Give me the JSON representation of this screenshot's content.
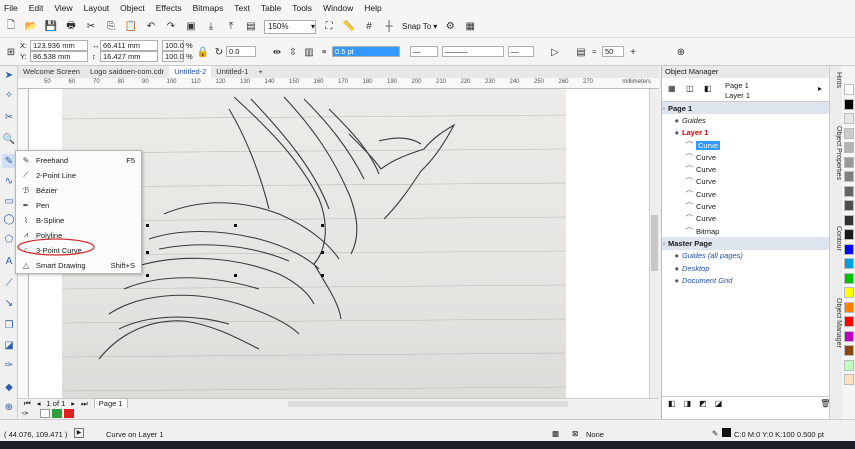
{
  "menu": [
    "File",
    "Edit",
    "View",
    "Layout",
    "Object",
    "Effects",
    "Bitmaps",
    "Text",
    "Table",
    "Tools",
    "Window",
    "Help"
  ],
  "toolbar": {
    "zoom": "150%",
    "snap_label": "Snap To"
  },
  "props": {
    "x": "123.936 mm",
    "y": "86.538 mm",
    "w": "66.411 mm",
    "h": "16.427 mm",
    "scale_x": "100.0",
    "scale_y": "100.0",
    "pct": "%",
    "angle": "0.0",
    "outline": "0.5 pt",
    "smooth": "50"
  },
  "tabs": [
    "Welcome Screen",
    "Logo saidoen-com.cdr",
    "Untitled-2",
    "Untitled-1"
  ],
  "active_tab": 2,
  "ruler_unit": "millimeters",
  "ruler_ticks": [
    "50",
    "60",
    "70",
    "80",
    "90",
    "100",
    "110",
    "120",
    "130",
    "140",
    "150",
    "160",
    "170",
    "180",
    "190",
    "200",
    "210",
    "220",
    "230",
    "240",
    "250",
    "260",
    "270"
  ],
  "flyout": [
    {
      "label": "Freehand",
      "shortcut": "F5",
      "icon": "freehand-icon"
    },
    {
      "label": "2-Point Line",
      "shortcut": "",
      "icon": "line-icon"
    },
    {
      "label": "Bézier",
      "shortcut": "",
      "icon": "bezier-icon"
    },
    {
      "label": "Pen",
      "shortcut": "",
      "icon": "pen-icon"
    },
    {
      "label": "B-Spline",
      "shortcut": "",
      "icon": "bspline-icon"
    },
    {
      "label": "Polyline",
      "shortcut": "",
      "icon": "polyline-icon"
    },
    {
      "label": "3-Point Curve",
      "shortcut": "",
      "icon": "curve-icon"
    },
    {
      "label": "Smart Drawing",
      "shortcut": "Shift+S",
      "icon": "smart-drawing-icon"
    }
  ],
  "docbar": {
    "page_count": "1 of 1",
    "page_tab": "Page 1"
  },
  "status": {
    "coords": "( 44.076, 109.471 )",
    "message": "Curve on Layer 1",
    "fill": "None",
    "outline_info": "C:0 M:0 Y:0 K:100  0.500 pt"
  },
  "object_manager": {
    "title": "Object Manager",
    "page": "Page 1",
    "layer": "Layer 1",
    "rows": [
      {
        "text": "Page 1",
        "level": 0,
        "style": "section"
      },
      {
        "text": "Guides",
        "level": 1,
        "style": "italic"
      },
      {
        "text": "Layer 1",
        "level": 1,
        "style": "red"
      },
      {
        "text": "Curve",
        "level": 2,
        "style": "selected"
      },
      {
        "text": "Curve",
        "level": 2,
        "style": "normal"
      },
      {
        "text": "Curve",
        "level": 2,
        "style": "normal"
      },
      {
        "text": "Curve",
        "level": 2,
        "style": "normal"
      },
      {
        "text": "Curve",
        "level": 2,
        "style": "normal"
      },
      {
        "text": "Curve",
        "level": 2,
        "style": "normal"
      },
      {
        "text": "Curve",
        "level": 2,
        "style": "normal"
      },
      {
        "text": "Bitmap",
        "level": 2,
        "style": "normal"
      },
      {
        "text": "Master Page",
        "level": 0,
        "style": "section"
      },
      {
        "text": "Guides (all pages)",
        "level": 1,
        "style": "blue-italic"
      },
      {
        "text": "Desktop",
        "level": 1,
        "style": "blue-italic"
      },
      {
        "text": "Document Grid",
        "level": 1,
        "style": "blue-italic"
      }
    ]
  },
  "dockers": [
    "Hints",
    "Object Properties",
    "Contour",
    "Object Manager"
  ],
  "palette": [
    "#ffffff",
    "#000000",
    "#e6e6e6",
    "#cccccc",
    "#b3b3b3",
    "#999999",
    "#808080",
    "#666666",
    "#4d4d4d",
    "#333333",
    "#1a1a1a",
    "#0000ff",
    "#00a0e0",
    "#00c000",
    "#ffff00",
    "#ff8000",
    "#ff0000",
    "#c000c0",
    "#8b4513",
    "#c0ffc0",
    "#ffe0c0"
  ],
  "colors": {
    "accent": "#1f4ea8",
    "highlight_ring": "#d32f2f",
    "layer_red": "#cc0000",
    "selection": "#3399ff"
  }
}
